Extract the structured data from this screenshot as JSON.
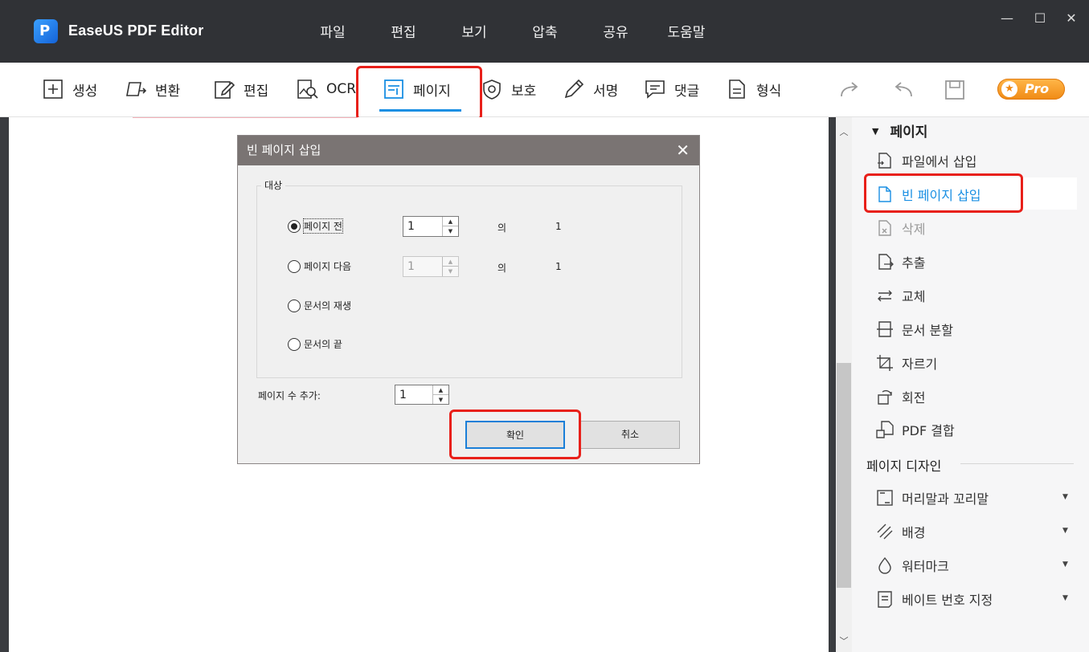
{
  "app": {
    "title": "EaseUS PDF Editor",
    "logo_letter": "P"
  },
  "menu": [
    "파일",
    "편집",
    "보기",
    "압축",
    "공유",
    "도움말"
  ],
  "window_controls": {
    "minimize": "—",
    "maximize": "☐",
    "close": "✕"
  },
  "toolbar": {
    "tools": [
      {
        "id": "create",
        "label": "생성",
        "icon": "plus-square-icon"
      },
      {
        "id": "convert",
        "label": "변환",
        "icon": "convert-icon"
      },
      {
        "id": "edit",
        "label": "편집",
        "icon": "edit-pen-icon"
      },
      {
        "id": "ocr",
        "label": "OCR",
        "icon": "ocr-icon"
      },
      {
        "id": "page",
        "label": "페이지",
        "icon": "page-icon",
        "active": true
      },
      {
        "id": "protect",
        "label": "보호",
        "icon": "shield-icon"
      },
      {
        "id": "sign",
        "label": "서명",
        "icon": "pen-icon"
      },
      {
        "id": "comment",
        "label": "댓글",
        "icon": "comment-icon"
      },
      {
        "id": "form",
        "label": "형식",
        "icon": "form-icon"
      }
    ],
    "pro_label": "Pro",
    "accent_color": "#1a8fe3",
    "highlight_color": "#e8201a"
  },
  "right_panel": {
    "page_section": "페이지",
    "items": [
      {
        "label": "파일에서 삽입",
        "icon": "insert-from-file-icon"
      },
      {
        "label": "빈 페이지 삽입",
        "icon": "blank-page-icon",
        "selected": true
      },
      {
        "label": "삭제",
        "icon": "delete-page-icon",
        "disabled": true
      },
      {
        "label": "추출",
        "icon": "extract-icon"
      },
      {
        "label": "교체",
        "icon": "replace-icon"
      },
      {
        "label": "문서 분할",
        "icon": "split-icon"
      },
      {
        "label": "자르기",
        "icon": "crop-icon"
      },
      {
        "label": "회전",
        "icon": "rotate-icon"
      },
      {
        "label": "PDF 결합",
        "icon": "merge-icon"
      }
    ],
    "design_section": "페이지 디자인",
    "design_items": [
      {
        "label": "머리말과 꼬리말",
        "icon": "header-footer-icon"
      },
      {
        "label": "배경",
        "icon": "background-icon"
      },
      {
        "label": "워터마크",
        "icon": "watermark-icon"
      },
      {
        "label": "베이트 번호 지정",
        "icon": "bates-number-icon"
      }
    ]
  },
  "dialog": {
    "title": "빈 페이지 삽입",
    "group_label": "대상",
    "options": [
      {
        "label": "페이지 전",
        "selected": true
      },
      {
        "label": "페이지 다음",
        "selected": false
      },
      {
        "label": "문서의 재생",
        "selected": false
      },
      {
        "label": "문서의 끝",
        "selected": false
      }
    ],
    "before_value": "1",
    "after_value": "1",
    "of_label": "의",
    "total_pages": "1",
    "add_count_label": "페이지 수 추가:",
    "add_count_value": "1",
    "ok_label": "확인",
    "cancel_label": "취소"
  }
}
